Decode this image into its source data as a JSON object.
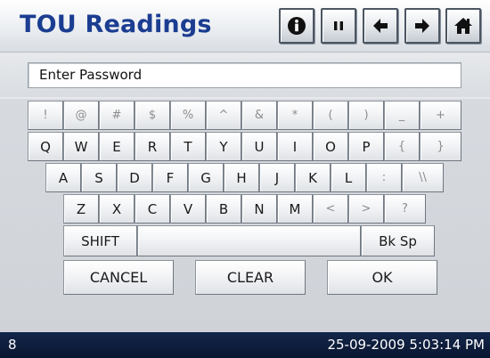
{
  "header": {
    "title": "TOU Readings",
    "buttons": [
      {
        "name": "info",
        "icon": "info-icon"
      },
      {
        "name": "pause",
        "icon": "pause-icon"
      },
      {
        "name": "back",
        "icon": "arrow-left-icon"
      },
      {
        "name": "forward",
        "icon": "arrow-right-icon"
      },
      {
        "name": "home",
        "icon": "home-icon"
      }
    ]
  },
  "password": {
    "value": "",
    "placeholder": "Enter Password"
  },
  "keyboard": {
    "row1": [
      "!",
      "@",
      "#",
      "$",
      "%",
      "^",
      "&",
      "*",
      "(",
      ")",
      "_",
      "+"
    ],
    "row2": [
      "Q",
      "W",
      "E",
      "R",
      "T",
      "Y",
      "U",
      "I",
      "O",
      "P",
      "{",
      "}"
    ],
    "row3": [
      "A",
      "S",
      "D",
      "F",
      "G",
      "H",
      "J",
      "K",
      "L",
      ":",
      "\\\\"
    ],
    "row4": [
      "Z",
      "X",
      "C",
      "V",
      "B",
      "N",
      "M",
      "<",
      ">",
      "?"
    ],
    "shift": "SHIFT",
    "space": "",
    "backspace": "Bk Sp",
    "cancel": "CANCEL",
    "clear": "CLEAR",
    "ok": "OK"
  },
  "status": {
    "left": "8",
    "datetime": "25-09-2009 5:03:14 PM"
  },
  "colors": {
    "title": "#1b3d91",
    "status_bar": "#0e1d3c",
    "dim_key_text": "#8c8c8c"
  }
}
